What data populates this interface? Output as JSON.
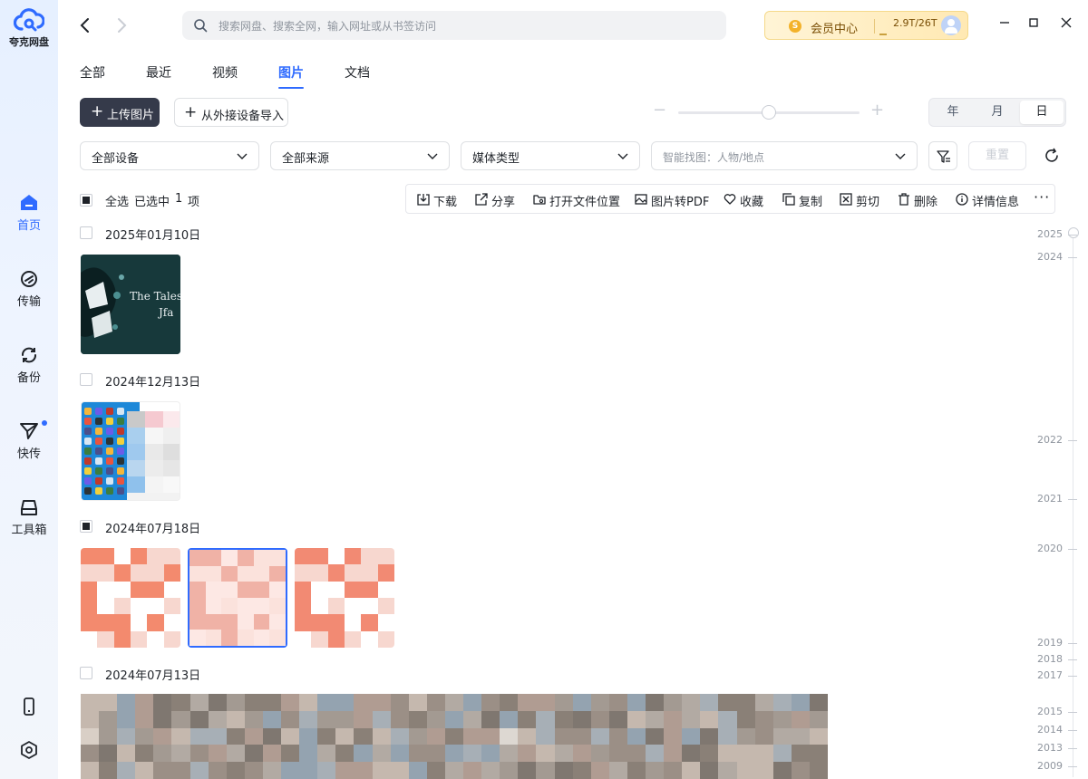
{
  "app": {
    "name": "夸克网盘"
  },
  "sidebar": {
    "items": [
      {
        "label": "首页",
        "icon": "home-icon",
        "active": true
      },
      {
        "label": "传输",
        "icon": "transfer-icon",
        "active": false
      },
      {
        "label": "备份",
        "icon": "backup-icon",
        "active": false
      },
      {
        "label": "快传",
        "icon": "quick-send-icon",
        "active": false,
        "badge": true
      },
      {
        "label": "工具箱",
        "icon": "toolbox-icon",
        "active": false
      }
    ],
    "bottom": [
      {
        "icon": "phone-icon"
      },
      {
        "icon": "settings-icon"
      }
    ]
  },
  "header": {
    "search_placeholder": "搜索网盘、搜索全网，输入网址或从书签访问",
    "vip_label": "会员中心",
    "vip_icon": "S",
    "storage": "2.9T/26T"
  },
  "tabs": [
    {
      "label": "全部",
      "active": false
    },
    {
      "label": "最近",
      "active": false
    },
    {
      "label": "视频",
      "active": false
    },
    {
      "label": "图片",
      "active": true
    },
    {
      "label": "文档",
      "active": false
    }
  ],
  "actions": {
    "upload_label": "上传图片",
    "import_label": "从外接设备导入",
    "zoom_level": 0.5,
    "view_modes": [
      {
        "label": "年",
        "active": false
      },
      {
        "label": "月",
        "active": false
      },
      {
        "label": "日",
        "active": true
      }
    ]
  },
  "filters": {
    "device": "全部设备",
    "source": "全部来源",
    "media_type": "媒体类型",
    "smart_search_placeholder": "智能找图：人物/地点",
    "reset_label": "重置"
  },
  "selection": {
    "select_all": "全选",
    "selected_prefix": "已选中",
    "selected_count": "1",
    "selected_suffix": "项"
  },
  "toolbar": [
    {
      "label": "下载",
      "icon": "download-icon"
    },
    {
      "label": "分享",
      "icon": "share-icon"
    },
    {
      "label": "打开文件位置",
      "icon": "folder-icon"
    },
    {
      "label": "图片转PDF",
      "icon": "image-icon"
    },
    {
      "label": "收藏",
      "icon": "heart-icon"
    },
    {
      "label": "复制",
      "icon": "copy-icon"
    },
    {
      "label": "剪切",
      "icon": "cut-icon"
    },
    {
      "label": "删除",
      "icon": "trash-icon"
    },
    {
      "label": "详情信息",
      "icon": "info-icon"
    }
  ],
  "groups": [
    {
      "date": "2025年01月10日",
      "partial": false
    },
    {
      "date": "2024年12月13日",
      "partial": false
    },
    {
      "date": "2024年07月18日",
      "partial": true
    },
    {
      "date": "2024年07月13日",
      "partial": false
    }
  ],
  "thumb_text": {
    "tales_1": "The Tales",
    "tales_2": "Jfa"
  },
  "timeline": [
    "2025",
    "2024",
    "2022",
    "2021",
    "2020",
    "2019",
    "2018",
    "2017",
    "2015",
    "2014",
    "2013",
    "2009"
  ],
  "colors": {
    "accent": "#2f6bff",
    "upload_bg": "#353a4a",
    "vip_bg": "#ffe9b3"
  }
}
